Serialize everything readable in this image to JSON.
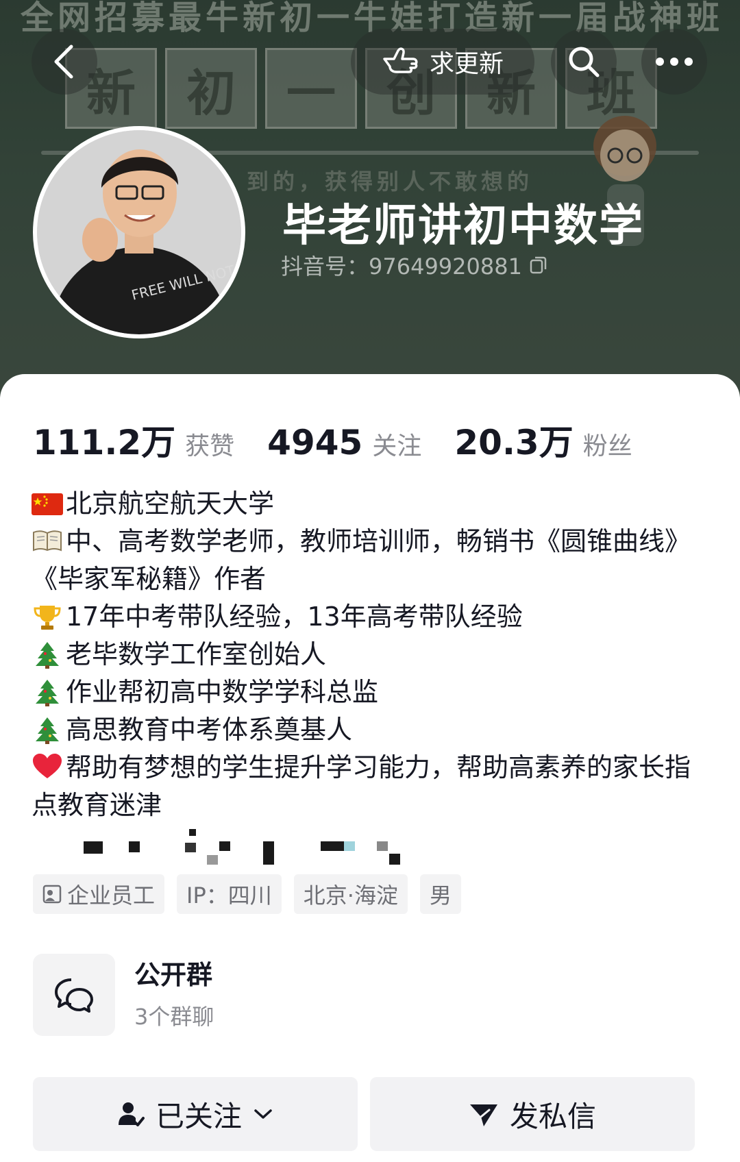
{
  "banner": {
    "top_text": "全网招募最牛新初一牛娃打造新一届战神班",
    "chalk_chars": [
      "新",
      "初",
      "一",
      "创",
      "新",
      "班"
    ],
    "chalk_sub": "到的，获得别人不敢想的"
  },
  "nav": {
    "update_label": "求更新"
  },
  "profile": {
    "nickname": "毕老师讲初中数学",
    "douyin_id": "抖音号：97649920881",
    "avatar_shirt_text": "FREE WILL NOT FREE"
  },
  "stats": [
    {
      "value": "111.2万",
      "label": "获赞"
    },
    {
      "value": "4945",
      "label": "关注"
    },
    {
      "value": "20.3万",
      "label": "粉丝"
    }
  ],
  "bio": {
    "line1": "北京航空航天大学",
    "line2": "中、高考数学老师，教师培训师，畅销书《圆锥曲线》《毕家军秘籍》作者",
    "line3": "17年中考带队经验，13年高考带队经验",
    "line4": "老毕数学工作室创始人",
    "line5": "作业帮初高中数学学科总监",
    "line6": "高思教育中考体系奠基人",
    "line7": "帮助有梦想的学生提升学习能力，帮助高素养的家长指点教育迷津",
    "emoji_icons": [
      "china-flag-icon",
      "book-icon",
      "trophy-icon",
      "tree-icon",
      "tree-icon",
      "tree-icon",
      "heart-icon"
    ]
  },
  "tags": [
    {
      "label": "企业员工",
      "icon": "person-badge-icon"
    },
    {
      "label": "IP：四川"
    },
    {
      "label": "北京·海淀"
    },
    {
      "label": "男"
    }
  ],
  "group": {
    "title": "公开群",
    "subtitle": "3个群聊"
  },
  "actions": {
    "follow_label": "已关注",
    "message_label": "发私信"
  },
  "colors": {
    "banner_green": "#3f5446",
    "text_primary": "#161823",
    "text_secondary": "#8a8b91",
    "button_bg": "#f2f2f4"
  }
}
